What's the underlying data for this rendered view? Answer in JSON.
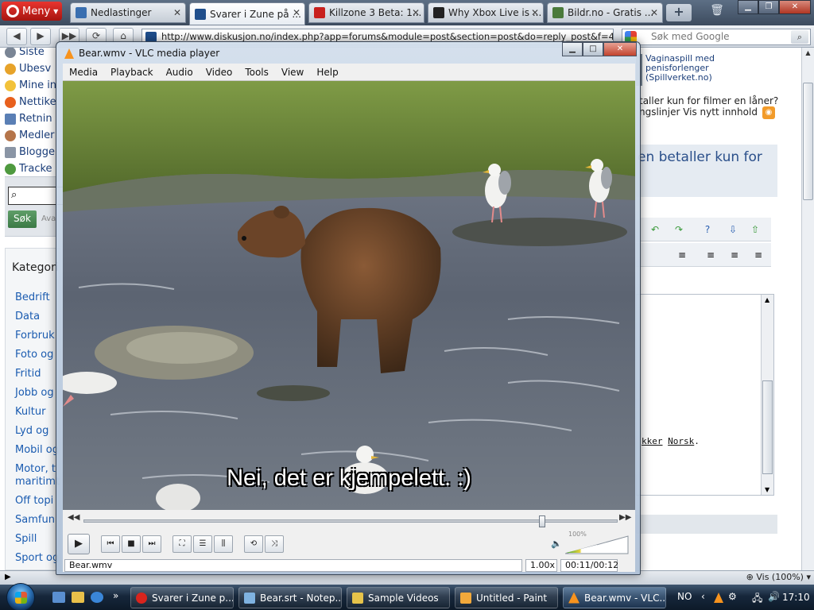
{
  "browser": {
    "menu_label": "Meny",
    "tabs": [
      {
        "label": "Nedlastinger",
        "color": "#3a6fb0"
      },
      {
        "label": "Svarer i Zune på ...",
        "color": "#1f4e8c"
      },
      {
        "label": "Killzone 3 Beta: 1...",
        "color": "#c8201d"
      },
      {
        "label": "Why Xbox Live is ...",
        "color": "#222222"
      },
      {
        "label": "Bildr.no - Gratis ...",
        "color": "#4a7a3a"
      }
    ],
    "url": "http://www.diskusjon.no/index.php?app=forums&module=post&section=post&do=reply_post&f=4108",
    "search_placeholder": "Søk med Google",
    "zoom_label": "Vis (100%)"
  },
  "webpage": {
    "left_nav": [
      "Siste",
      "Ubesv",
      "Mine in",
      "Nettike",
      "Retnin",
      "Medler",
      "Blogge",
      "Tracke"
    ],
    "search_button": "Søk",
    "search_extra": "Ava",
    "categories_heading": "Kategori",
    "categories": [
      "Bedrift",
      "Data",
      "Forbruk",
      "Foto og",
      "Fritid",
      "Jobb og",
      "Kultur",
      "Lyd og",
      "Mobil og",
      "Motor, t",
      "maritimt",
      "Off topi",
      "Samfun",
      "Spill",
      "Sport og"
    ],
    "right_ad_text": "Vaginaspill med penisforlenger (Spillverket.no)",
    "right_line1": "taller kun for filmer en låner?",
    "right_line2": "ngslinjer  Vis nytt innhold",
    "right_heading": "en betaller kun for",
    "editor_text_prefix": "kker",
    "editor_text_word": "Norsk",
    "editor_text_suffix": "."
  },
  "vlc": {
    "title": "Bear.wmv - VLC media player",
    "menu": [
      "Media",
      "Playback",
      "Audio",
      "Video",
      "Tools",
      "View",
      "Help"
    ],
    "subtitle": "Nei, det er kjempelett. :)",
    "seek_position": 0.86,
    "volume_label": "100%",
    "status_file": "Bear.wmv",
    "speed": "1.00x",
    "time": "00:11/00:12"
  },
  "taskbar": {
    "items": [
      {
        "label": "Svarer i Zune p...",
        "color": "#d9241d"
      },
      {
        "label": "Bear.srt - Notep...",
        "color": "#7fb2e0"
      },
      {
        "label": "Sample Videos",
        "color": "#e6c34a"
      },
      {
        "label": "Untitled - Paint",
        "color": "#f2a93b"
      },
      {
        "label": "Bear.wmv - VLC...",
        "color": "#f7931e"
      }
    ],
    "lang": "NO",
    "clock": "17:10"
  }
}
